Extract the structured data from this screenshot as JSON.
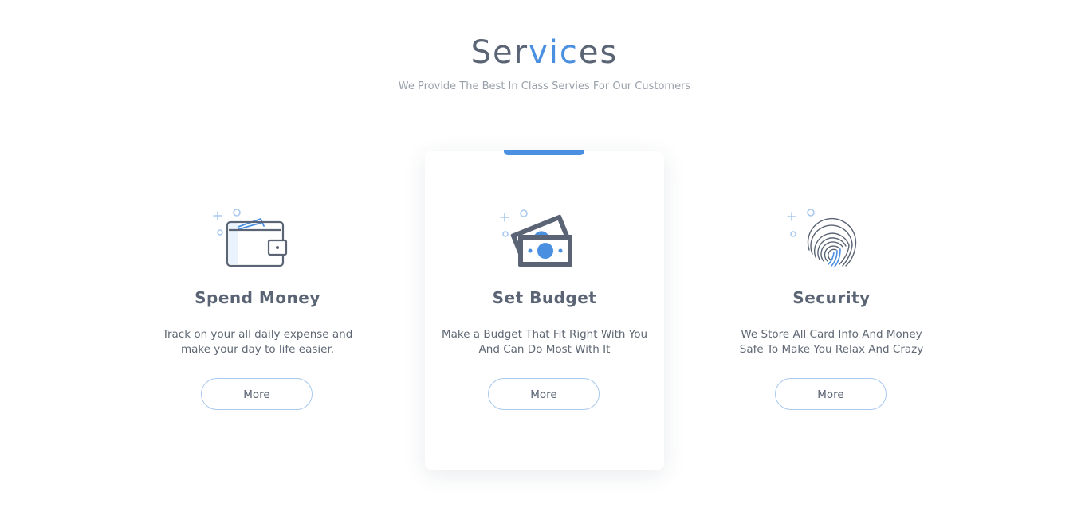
{
  "section": {
    "title_part1": "Ser",
    "title_accent": "vic",
    "title_part2": "es",
    "subtitle": "We Provide The Best In Class Servies For Our Customers"
  },
  "cards": [
    {
      "icon": "wallet-icon",
      "title": "Spend Money",
      "desc_line1": "Track on your all daily expense and",
      "desc_line2": "make your day to life easier.",
      "button": "More"
    },
    {
      "icon": "money-bills-icon",
      "title": "Set Budget",
      "desc_line1": "Make a Budget That Fit Right With You",
      "desc_line2": "And Can Do Most With It",
      "button": "More"
    },
    {
      "icon": "fingerprint-icon",
      "title": "Security",
      "desc_line1": "We Store All Card Info And Money",
      "desc_line2": "Safe To Make You Relax And Crazy",
      "button": "More"
    }
  ],
  "colors": {
    "accent": "#4a8fe0",
    "heading": "#5a6474",
    "subtitle": "#9aa1ab",
    "button_border": "#a9c9ee"
  }
}
